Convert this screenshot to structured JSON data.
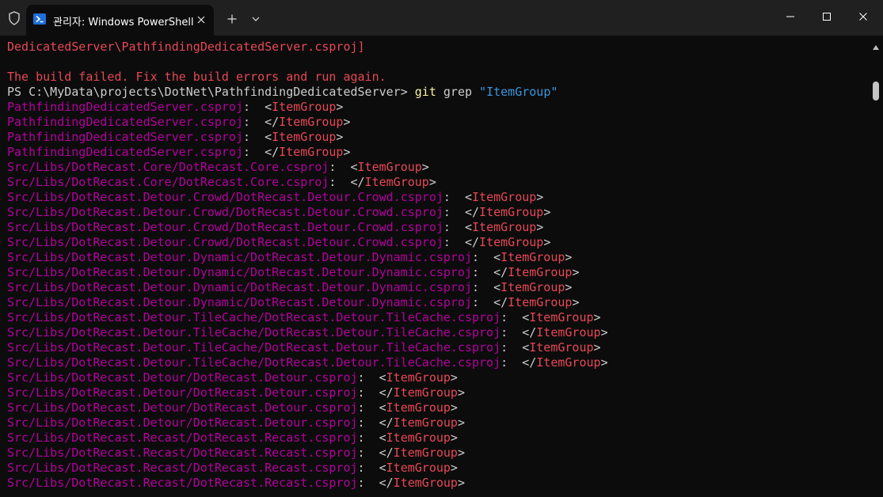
{
  "window": {
    "tab_title": "관리자: Windows PowerShell",
    "icons": [
      "shield-icon",
      "powershell-icon",
      "close-icon",
      "plus-icon",
      "chevron-down-icon",
      "minimize-icon",
      "maximize-icon",
      "window-close-icon"
    ]
  },
  "terminal": {
    "lines": [
      {
        "type": "error",
        "text": "DedicatedServer\\PathfindingDedicatedServer.csproj]"
      },
      {
        "type": "blank",
        "text": ""
      },
      {
        "type": "error",
        "text": "The build failed. Fix the build errors and run again."
      },
      {
        "type": "prompt",
        "prompt": "PS C:\\MyData\\projects\\DotNet\\PathfindingDedicatedServer> ",
        "cmd": "git",
        "arg": " grep ",
        "str": "\"ItemGroup\""
      },
      {
        "type": "match",
        "path": "PathfindingDedicatedServer.csproj",
        "sep": ":  <",
        "tag": "ItemGroup",
        "end": ">"
      },
      {
        "type": "match",
        "path": "PathfindingDedicatedServer.csproj",
        "sep": ":  </",
        "tag": "ItemGroup",
        "end": ">"
      },
      {
        "type": "match",
        "path": "PathfindingDedicatedServer.csproj",
        "sep": ":  <",
        "tag": "ItemGroup",
        "end": ">"
      },
      {
        "type": "match",
        "path": "PathfindingDedicatedServer.csproj",
        "sep": ":  </",
        "tag": "ItemGroup",
        "end": ">"
      },
      {
        "type": "match",
        "path": "Src/Libs/DotRecast.Core/DotRecast.Core.csproj",
        "sep": ":  <",
        "tag": "ItemGroup",
        "end": ">"
      },
      {
        "type": "match",
        "path": "Src/Libs/DotRecast.Core/DotRecast.Core.csproj",
        "sep": ":  </",
        "tag": "ItemGroup",
        "end": ">"
      },
      {
        "type": "match",
        "path": "Src/Libs/DotRecast.Detour.Crowd/DotRecast.Detour.Crowd.csproj",
        "sep": ":  <",
        "tag": "ItemGroup",
        "end": ">"
      },
      {
        "type": "match",
        "path": "Src/Libs/DotRecast.Detour.Crowd/DotRecast.Detour.Crowd.csproj",
        "sep": ":  </",
        "tag": "ItemGroup",
        "end": ">"
      },
      {
        "type": "match",
        "path": "Src/Libs/DotRecast.Detour.Crowd/DotRecast.Detour.Crowd.csproj",
        "sep": ":  <",
        "tag": "ItemGroup",
        "end": ">"
      },
      {
        "type": "match",
        "path": "Src/Libs/DotRecast.Detour.Crowd/DotRecast.Detour.Crowd.csproj",
        "sep": ":  </",
        "tag": "ItemGroup",
        "end": ">"
      },
      {
        "type": "match",
        "path": "Src/Libs/DotRecast.Detour.Dynamic/DotRecast.Detour.Dynamic.csproj",
        "sep": ":  <",
        "tag": "ItemGroup",
        "end": ">"
      },
      {
        "type": "match",
        "path": "Src/Libs/DotRecast.Detour.Dynamic/DotRecast.Detour.Dynamic.csproj",
        "sep": ":  </",
        "tag": "ItemGroup",
        "end": ">"
      },
      {
        "type": "match",
        "path": "Src/Libs/DotRecast.Detour.Dynamic/DotRecast.Detour.Dynamic.csproj",
        "sep": ":  <",
        "tag": "ItemGroup",
        "end": ">"
      },
      {
        "type": "match",
        "path": "Src/Libs/DotRecast.Detour.Dynamic/DotRecast.Detour.Dynamic.csproj",
        "sep": ":  </",
        "tag": "ItemGroup",
        "end": ">"
      },
      {
        "type": "match",
        "path": "Src/Libs/DotRecast.Detour.TileCache/DotRecast.Detour.TileCache.csproj",
        "sep": ":  <",
        "tag": "ItemGroup",
        "end": ">"
      },
      {
        "type": "match",
        "path": "Src/Libs/DotRecast.Detour.TileCache/DotRecast.Detour.TileCache.csproj",
        "sep": ":  </",
        "tag": "ItemGroup",
        "end": ">"
      },
      {
        "type": "match",
        "path": "Src/Libs/DotRecast.Detour.TileCache/DotRecast.Detour.TileCache.csproj",
        "sep": ":  <",
        "tag": "ItemGroup",
        "end": ">"
      },
      {
        "type": "match",
        "path": "Src/Libs/DotRecast.Detour.TileCache/DotRecast.Detour.TileCache.csproj",
        "sep": ":  </",
        "tag": "ItemGroup",
        "end": ">"
      },
      {
        "type": "match",
        "path": "Src/Libs/DotRecast.Detour/DotRecast.Detour.csproj",
        "sep": ":  <",
        "tag": "ItemGroup",
        "end": ">"
      },
      {
        "type": "match",
        "path": "Src/Libs/DotRecast.Detour/DotRecast.Detour.csproj",
        "sep": ":  </",
        "tag": "ItemGroup",
        "end": ">"
      },
      {
        "type": "match",
        "path": "Src/Libs/DotRecast.Detour/DotRecast.Detour.csproj",
        "sep": ":  <",
        "tag": "ItemGroup",
        "end": ">"
      },
      {
        "type": "match",
        "path": "Src/Libs/DotRecast.Detour/DotRecast.Detour.csproj",
        "sep": ":  </",
        "tag": "ItemGroup",
        "end": ">"
      },
      {
        "type": "match",
        "path": "Src/Libs/DotRecast.Recast/DotRecast.Recast.csproj",
        "sep": ":  <",
        "tag": "ItemGroup",
        "end": ">"
      },
      {
        "type": "match",
        "path": "Src/Libs/DotRecast.Recast/DotRecast.Recast.csproj",
        "sep": ":  </",
        "tag": "ItemGroup",
        "end": ">"
      },
      {
        "type": "match",
        "path": "Src/Libs/DotRecast.Recast/DotRecast.Recast.csproj",
        "sep": ":  <",
        "tag": "ItemGroup",
        "end": ">"
      },
      {
        "type": "match",
        "path": "Src/Libs/DotRecast.Recast/DotRecast.Recast.csproj",
        "sep": ":  </",
        "tag": "ItemGroup",
        "end": ">"
      }
    ]
  },
  "colors": {
    "background": "#0c0c0c",
    "titlebar": "#202020",
    "error": "#e74856",
    "path": "#b4009e",
    "command": "#f9f1a5",
    "string": "#3a96dd",
    "text": "#cccccc"
  }
}
